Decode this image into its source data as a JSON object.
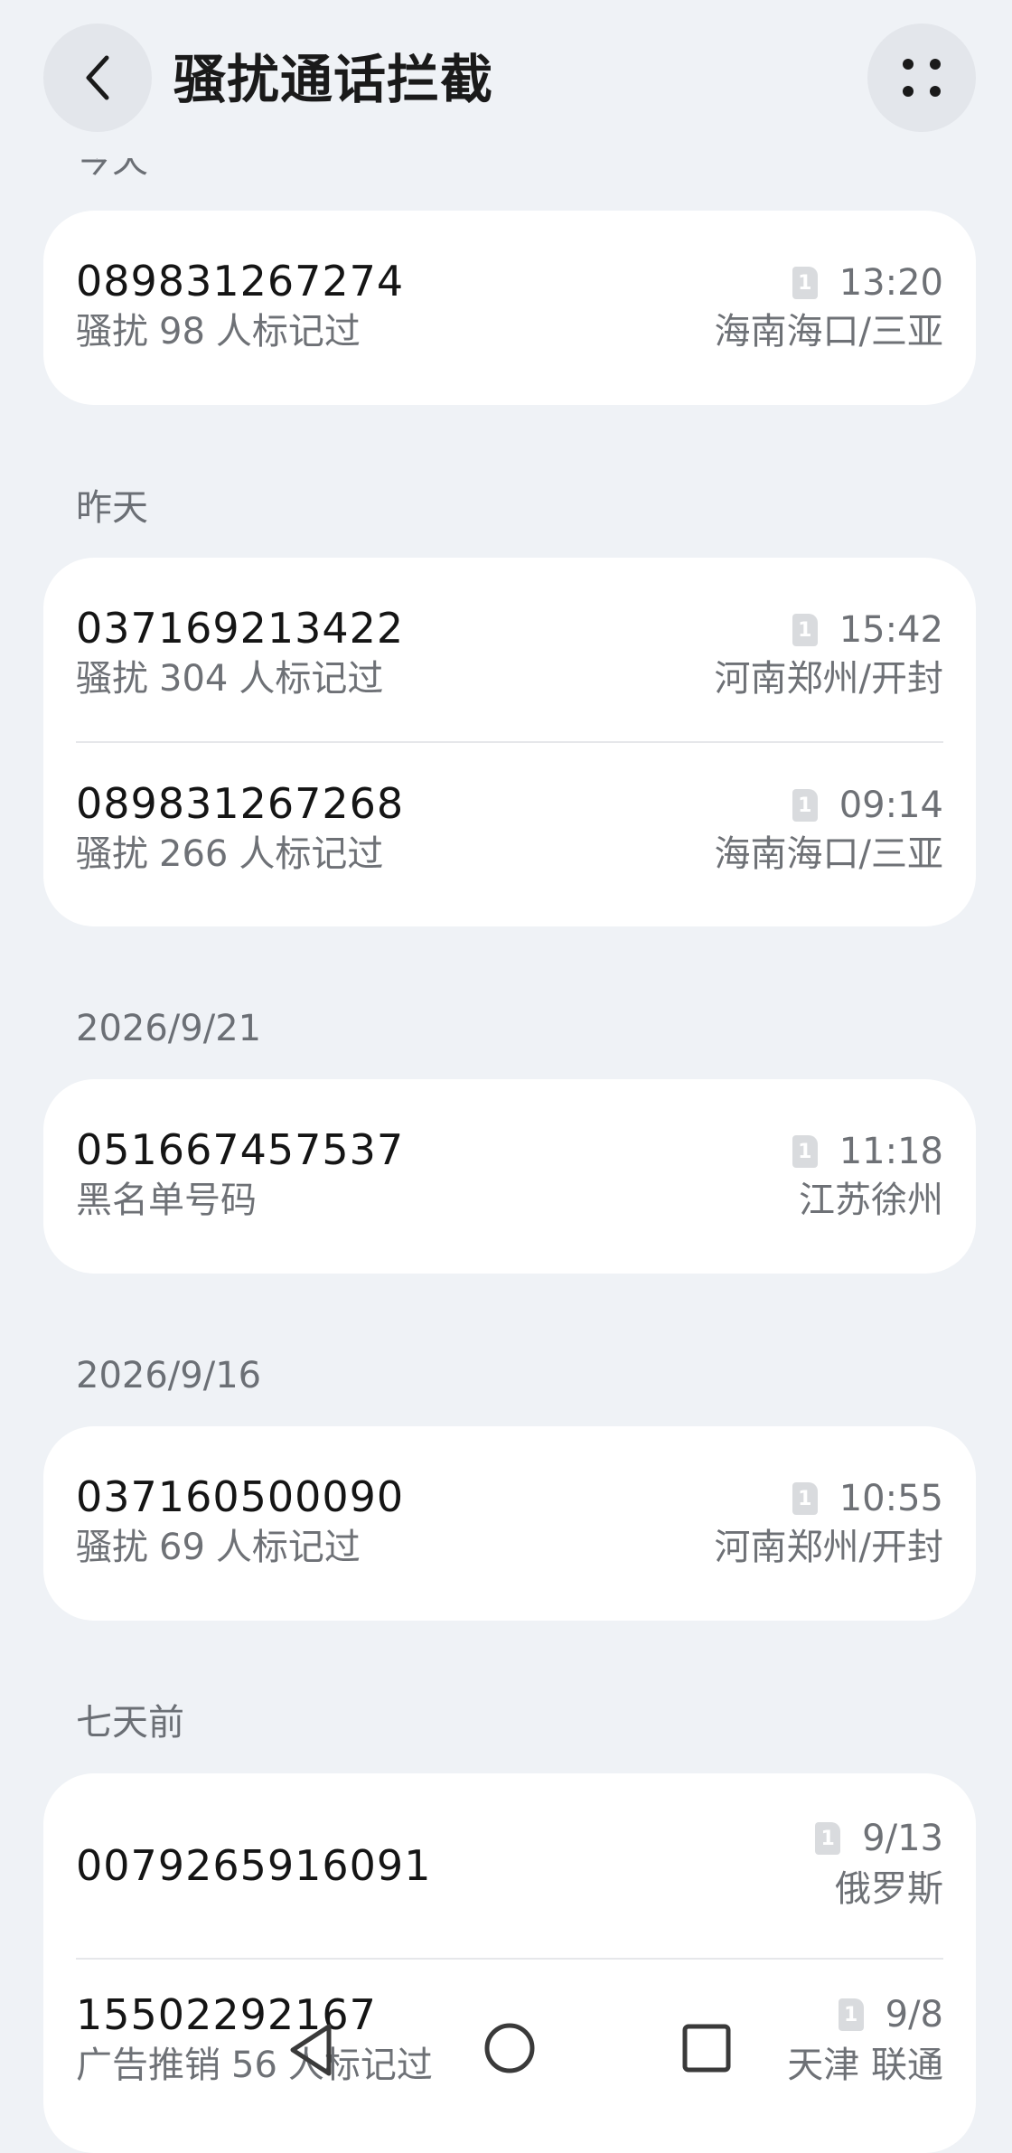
{
  "header": {
    "title": "骚扰通话拦截"
  },
  "sections": {
    "today": "今天",
    "yesterday": "昨天",
    "d0921": "2026/9/21",
    "d0916": "2026/9/16",
    "week": "七天前"
  },
  "calls": [
    {
      "number": "089831267274",
      "tag": "骚扰",
      "count": "98",
      "suffix": "人标记过",
      "time": "13:20",
      "location": "海南海口/三亚"
    },
    {
      "number": "037169213422",
      "tag": "骚扰",
      "count": "304",
      "suffix": "人标记过",
      "time": "15:42",
      "location": "河南郑州/开封"
    },
    {
      "number": "089831267268",
      "tag": "骚扰",
      "count": "266",
      "suffix": "人标记过",
      "time": "09:14",
      "location": "海南海口/三亚"
    },
    {
      "number": "051667457537",
      "tag": "黑名单号码",
      "time": "11:18",
      "location": "江苏徐州"
    },
    {
      "number": "037160500090",
      "tag": "骚扰",
      "count": "69",
      "suffix": "人标记过",
      "time": "10:55",
      "location": "河南郑州/开封"
    },
    {
      "number": "0079265916091",
      "time": "9/13",
      "location": "俄罗斯"
    },
    {
      "number": "15502292167",
      "tag": "广告推销",
      "count": "56",
      "suffix": "人标记过",
      "time": "9/8",
      "location": "天津 联通"
    }
  ],
  "sim_label": "1",
  "colors": {
    "background": "#eff2f6",
    "card": "#ffffff",
    "secondary_text": "#6e7176"
  }
}
